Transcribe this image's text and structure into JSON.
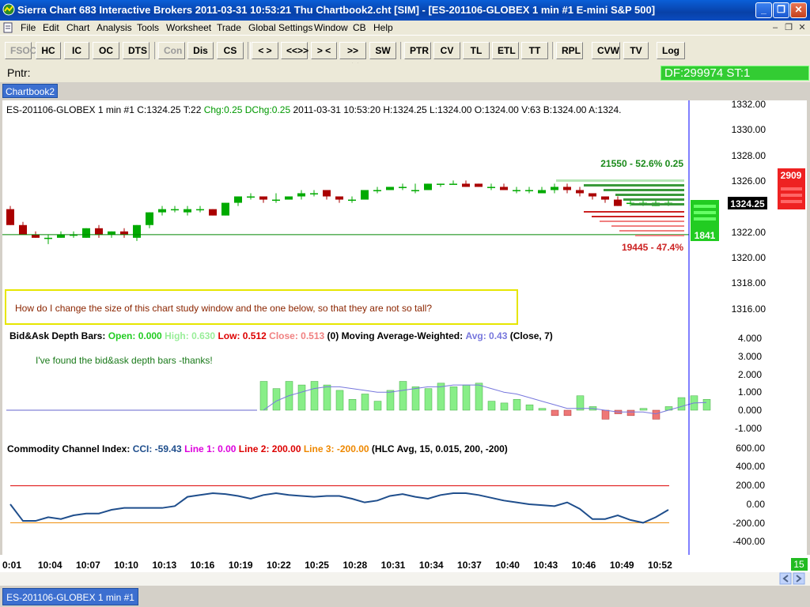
{
  "window": {
    "title": "Sierra Chart 683 Interactive Brokers 2011-03-31   10:53:21  Thu    Chartbook2.cht [SIM] - [ES-201106-GLOBEX  1 min   #1  E-mini S&P 500]",
    "minimize": "_",
    "maximize": "❐",
    "close": "✕"
  },
  "menu": [
    "File",
    "Edit",
    "Chart",
    "Analysis",
    "Tools",
    "Worksheet",
    "Trade",
    "Global Settings",
    "Window",
    "CB",
    "Help"
  ],
  "toolbar": {
    "buttons": [
      {
        "label": "FSOC",
        "disabled": true
      },
      {
        "label": "HC"
      },
      {
        "label": "IC"
      },
      {
        "label": "OC"
      },
      {
        "label": "DTS"
      },
      {
        "label": "Con",
        "disabled": true
      },
      {
        "label": "Dis"
      },
      {
        "label": "CS"
      },
      {
        "label": "< >"
      },
      {
        "label": "<<>>"
      },
      {
        "label": "> <"
      },
      {
        "label": ">><<"
      },
      {
        "label": "SW"
      },
      {
        "label": "PTR"
      },
      {
        "label": "CV"
      },
      {
        "label": "TL"
      },
      {
        "label": "ETL"
      },
      {
        "label": "TT"
      },
      {
        "label": "RPL"
      },
      {
        "label": "CVW"
      },
      {
        "label": "TV"
      },
      {
        "label": "Log"
      }
    ]
  },
  "pointer": {
    "label": "Pntr:",
    "df_status": "DF:299974  ST:1"
  },
  "chartbook_tab": "Chartbook2",
  "header": {
    "symbol": "ES-201106-GLOBEX  1 min   #1 C:1324.25 T:22 ",
    "chg": "Chg:0.25",
    "dchg": "DChg:0.25",
    "rest": " 2011-03-31 10:53:20 H:1324.25 L:1324.00 O:1324.00 V:63 B:1324.00 A:1324."
  },
  "price_axis": [
    "1332.00",
    "1330.00",
    "1328.00",
    "1326.00",
    "1324.25",
    "1322.00",
    "1320.00",
    "1318.00",
    "1316.00"
  ],
  "last_price": "1324.25",
  "ask_depth_total": "2909",
  "bid_depth_total": "1841",
  "dom_top_label": "21550 - 52.6%   0.25",
  "dom_bottom_label": "19445 - 47.4%",
  "question_note": "How do I change the size of this chart study window and the one below, so that they are not so tall?",
  "bidask_study": {
    "name": "Bid&Ask Depth Bars:",
    "open": "Open: 0.000",
    "high": "High: 0.630",
    "low": "Low: 0.512",
    "close": "Close: 0.513",
    "zero": "(0)",
    "ma_name": "Moving Average-Weighted:",
    "avg": "Avg: 0.43",
    "params": "(Close, 7)",
    "note": "I've found the bid&ask depth bars -thanks!",
    "axis": [
      "4.000",
      "3.000",
      "2.000",
      "1.000",
      "0.000",
      "-1.000"
    ]
  },
  "cci_study": {
    "name": "Commodity Channel Index:",
    "cci": "CCI: -59.43",
    "line1": "Line 1: 0.00",
    "line2": "Line 2: 200.00",
    "line3": "Line 3: -200.00",
    "params": "(HLC Avg, 15, 0.015, 200, -200)",
    "axis": [
      "600.00",
      "400.00",
      "200.00",
      "0.00",
      "-200.00",
      "-400.00"
    ]
  },
  "time_axis": [
    "0:01",
    "10:04",
    "10:07",
    "10:10",
    "10:13",
    "10:16",
    "10:19",
    "10:22",
    "10:25",
    "10:28",
    "10:31",
    "10:34",
    "10:37",
    "10:40",
    "10:43",
    "10:46",
    "10:49",
    "10:52"
  ],
  "corner_value": "15",
  "bottom_tab": "ES-201106-GLOBEX  1 min   #1",
  "colors": {
    "up": "#00aa00",
    "down": "#aa0000",
    "accent_blue": "#0a4bc0",
    "question_border": "#e6e600",
    "cci_line": "#1f4e8c"
  },
  "chart_data": [
    {
      "type": "candlestick",
      "title": "ES-201106-GLOBEX 1 min",
      "x": [
        "10:01",
        "10:02",
        "10:03",
        "10:04",
        "10:05",
        "10:06",
        "10:07",
        "10:08",
        "10:09",
        "10:10",
        "10:11",
        "10:12",
        "10:13",
        "10:14",
        "10:15",
        "10:16",
        "10:17",
        "10:18",
        "10:19",
        "10:20",
        "10:21",
        "10:22",
        "10:23",
        "10:24",
        "10:25",
        "10:26",
        "10:27",
        "10:28",
        "10:29",
        "10:30",
        "10:31",
        "10:32",
        "10:33",
        "10:34",
        "10:35",
        "10:36",
        "10:37",
        "10:38",
        "10:39",
        "10:40",
        "10:41",
        "10:42",
        "10:43",
        "10:44",
        "10:45",
        "10:46",
        "10:47",
        "10:48",
        "10:49",
        "10:50",
        "10:51",
        "10:52",
        "10:53"
      ],
      "ohlc": [
        [
          1323.75,
          1324.0,
          1322.5,
          1322.5
        ],
        [
          1322.5,
          1322.75,
          1321.75,
          1321.75
        ],
        [
          1321.75,
          1322.0,
          1321.5,
          1321.5
        ],
        [
          1321.5,
          1321.75,
          1321.0,
          1321.5
        ],
        [
          1321.5,
          1322.0,
          1321.5,
          1321.75
        ],
        [
          1321.75,
          1322.0,
          1321.5,
          1321.75
        ],
        [
          1321.5,
          1322.25,
          1321.5,
          1322.25
        ],
        [
          1322.25,
          1322.5,
          1321.5,
          1321.75
        ],
        [
          1321.75,
          1322.0,
          1321.5,
          1322.0
        ],
        [
          1322.0,
          1322.25,
          1321.5,
          1321.75
        ],
        [
          1321.5,
          1322.5,
          1321.25,
          1322.5
        ],
        [
          1322.5,
          1323.5,
          1322.25,
          1323.5
        ],
        [
          1323.5,
          1324.0,
          1323.25,
          1323.75
        ],
        [
          1323.75,
          1324.0,
          1323.5,
          1323.75
        ],
        [
          1323.5,
          1324.0,
          1323.25,
          1323.75
        ],
        [
          1323.75,
          1324.0,
          1323.5,
          1323.75
        ],
        [
          1323.75,
          1323.75,
          1323.25,
          1323.25
        ],
        [
          1323.25,
          1324.25,
          1323.25,
          1324.25
        ],
        [
          1324.25,
          1324.75,
          1324.0,
          1324.75
        ],
        [
          1324.75,
          1325.0,
          1324.5,
          1324.75
        ],
        [
          1324.75,
          1324.75,
          1324.25,
          1324.5
        ],
        [
          1324.5,
          1325.0,
          1324.25,
          1324.5
        ],
        [
          1324.5,
          1324.75,
          1324.5,
          1324.75
        ],
        [
          1324.75,
          1325.25,
          1324.5,
          1325.0
        ],
        [
          1325.0,
          1325.25,
          1324.75,
          1325.0
        ],
        [
          1325.25,
          1325.25,
          1324.5,
          1324.75
        ],
        [
          1324.75,
          1324.75,
          1324.25,
          1324.5
        ],
        [
          1324.5,
          1324.75,
          1324.25,
          1324.5
        ],
        [
          1324.5,
          1325.25,
          1324.5,
          1325.25
        ],
        [
          1325.25,
          1325.5,
          1325.0,
          1325.25
        ],
        [
          1325.25,
          1325.5,
          1325.25,
          1325.5
        ],
        [
          1325.5,
          1325.75,
          1325.25,
          1325.5
        ],
        [
          1325.25,
          1325.75,
          1325.0,
          1325.25
        ],
        [
          1325.25,
          1325.75,
          1325.25,
          1325.75
        ],
        [
          1325.75,
          1325.75,
          1325.5,
          1325.75
        ],
        [
          1325.75,
          1326.0,
          1325.75,
          1325.75
        ],
        [
          1325.75,
          1326.0,
          1325.5,
          1325.5
        ],
        [
          1325.75,
          1325.75,
          1325.5,
          1325.5
        ],
        [
          1325.5,
          1325.75,
          1325.25,
          1325.5
        ],
        [
          1325.5,
          1325.75,
          1325.25,
          1325.25
        ],
        [
          1325.25,
          1325.5,
          1325.0,
          1325.25
        ],
        [
          1325.25,
          1325.5,
          1325.0,
          1325.25
        ],
        [
          1325.0,
          1325.5,
          1325.0,
          1325.25
        ],
        [
          1325.25,
          1325.75,
          1325.0,
          1325.5
        ],
        [
          1325.5,
          1325.75,
          1325.0,
          1325.25
        ],
        [
          1325.25,
          1325.5,
          1324.75,
          1325.0
        ],
        [
          1325.0,
          1325.0,
          1324.5,
          1324.75
        ],
        [
          1324.75,
          1324.75,
          1324.25,
          1324.5
        ],
        [
          1324.5,
          1324.75,
          1324.0,
          1324.0
        ],
        [
          1324.25,
          1324.5,
          1324.0,
          1324.25
        ],
        [
          1324.25,
          1324.5,
          1324.0,
          1324.25
        ],
        [
          1324.0,
          1324.5,
          1324.0,
          1324.25
        ],
        [
          1324.25,
          1324.5,
          1324.0,
          1324.25
        ]
      ],
      "reference_line": 1321.75,
      "ylim": [
        1315.0,
        1333.0
      ]
    },
    {
      "type": "bar",
      "title": "Bid&Ask Depth Bars",
      "x_start_index": 20,
      "values": [
        1.6,
        1.2,
        1.6,
        1.4,
        1.6,
        1.4,
        1.1,
        0.6,
        0.9,
        0.5,
        1.1,
        1.6,
        1.3,
        1.2,
        1.5,
        1.3,
        1.4,
        1.5,
        0.5,
        0.4,
        0.6,
        0.3,
        0.1,
        -0.3,
        -0.3,
        0.8,
        0.2,
        -0.5,
        -0.2,
        -0.3,
        0.1,
        -0.5,
        0.2,
        0.7,
        0.8,
        0.6
      ],
      "ma": [
        0.0,
        0.5,
        0.8,
        1.0,
        1.2,
        1.3,
        1.3,
        1.2,
        1.1,
        1.0,
        1.0,
        1.1,
        1.2,
        1.3,
        1.3,
        1.4,
        1.4,
        1.4,
        1.2,
        1.0,
        0.9,
        0.7,
        0.5,
        0.3,
        0.1,
        0.1,
        0.1,
        0.0,
        -0.1,
        -0.1,
        -0.1,
        -0.2,
        0.0,
        0.2,
        0.4,
        0.43
      ],
      "ylim": [
        -1.5,
        4.5
      ]
    },
    {
      "type": "line",
      "title": "Commodity Channel Index",
      "values": [
        0,
        -180,
        -180,
        -140,
        -160,
        -120,
        -100,
        -100,
        -60,
        -40,
        -40,
        -40,
        -40,
        -20,
        80,
        100,
        120,
        110,
        90,
        60,
        100,
        120,
        100,
        90,
        80,
        90,
        90,
        60,
        20,
        40,
        90,
        110,
        80,
        60,
        100,
        120,
        120,
        100,
        70,
        40,
        20,
        0,
        -10,
        -20,
        20,
        -50,
        -160,
        -160,
        -120,
        -170,
        -200,
        -140,
        -60
      ],
      "lines": [
        0,
        200,
        -200
      ],
      "ylim": [
        -500,
        700
      ]
    }
  ]
}
